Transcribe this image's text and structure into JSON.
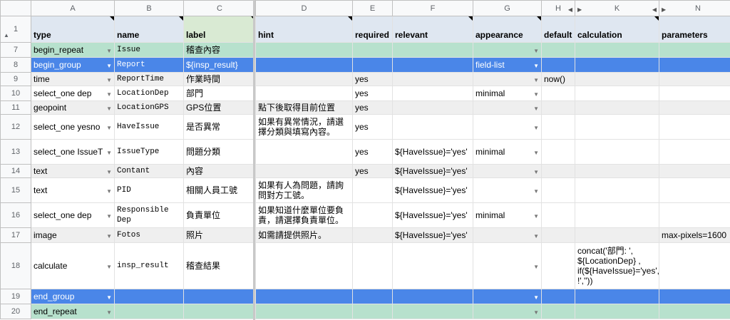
{
  "columns": [
    "A",
    "B",
    "C",
    "D",
    "E",
    "F",
    "G",
    "H",
    "K",
    "N"
  ],
  "headers": {
    "row_num": "1",
    "type": "type",
    "name": "name",
    "label": "label",
    "hint": "hint",
    "required": "required",
    "relevant": "relevant",
    "appearance": "appearance",
    "default": "default",
    "calculation": "calculation",
    "parameters": "parameters"
  },
  "rows": [
    {
      "num": "7",
      "type": "begin_repeat",
      "name": "Issue",
      "label": "稽查內容",
      "hint": "",
      "required": "",
      "relevant": "",
      "appearance": "",
      "default": "",
      "calculation": "",
      "parameters": ""
    },
    {
      "num": "8",
      "type": "begin_group",
      "name": "Report",
      "label": "${insp_result}",
      "hint": "",
      "required": "",
      "relevant": "",
      "appearance": "field-list",
      "default": "",
      "calculation": "",
      "parameters": ""
    },
    {
      "num": "9",
      "type": "time",
      "name": "ReportTime",
      "label": "作業時間",
      "hint": "",
      "required": "yes",
      "relevant": "",
      "appearance": "",
      "default": "now()",
      "calculation": "",
      "parameters": ""
    },
    {
      "num": "10",
      "type": "select_one dep",
      "name": "LocationDep",
      "label": "部門",
      "hint": "",
      "required": "yes",
      "relevant": "",
      "appearance": "minimal",
      "default": "",
      "calculation": "",
      "parameters": ""
    },
    {
      "num": "11",
      "type": "geopoint",
      "name": "LocationGPS",
      "label": "GPS位置",
      "hint": "點下後取得目前位置",
      "required": "yes",
      "relevant": "",
      "appearance": "",
      "default": "",
      "calculation": "",
      "parameters": ""
    },
    {
      "num": "12",
      "type": "select_one yesno",
      "name": "HaveIssue",
      "label": "是否異常",
      "hint": "如果有異常情況，請選擇分類與填寫內容。",
      "required": "yes",
      "relevant": "",
      "appearance": "",
      "default": "",
      "calculation": "",
      "parameters": ""
    },
    {
      "num": "13",
      "type": "select_one IssueT",
      "name": "IssueType",
      "label": "問題分類",
      "hint": "",
      "required": "yes",
      "relevant": "${HaveIssue}='yes'",
      "appearance": "minimal",
      "default": "",
      "calculation": "",
      "parameters": ""
    },
    {
      "num": "14",
      "type": "text",
      "name": "Contant",
      "label": "內容",
      "hint": "",
      "required": "yes",
      "relevant": "${HaveIssue}='yes'",
      "appearance": "",
      "default": "",
      "calculation": "",
      "parameters": ""
    },
    {
      "num": "15",
      "type": "text",
      "name": "PID",
      "label": "相關人員工號",
      "hint": "如果有人為問題，請詢問對方工號。",
      "required": "",
      "relevant": "${HaveIssue}='yes'",
      "appearance": "",
      "default": "",
      "calculation": "",
      "parameters": ""
    },
    {
      "num": "16",
      "type": "select_one dep",
      "name": "Responsible Dep",
      "label": "負責單位",
      "hint": "如果知道什麼單位要負責，請選擇負責單位。",
      "required": "",
      "relevant": "${HaveIssue}='yes'",
      "appearance": "minimal",
      "default": "",
      "calculation": "",
      "parameters": ""
    },
    {
      "num": "17",
      "type": "image",
      "name": "Fotos",
      "label": "照片",
      "hint": "如需請提供照片。",
      "required": "",
      "relevant": "${HaveIssue}='yes'",
      "appearance": "",
      "default": "",
      "calculation": "",
      "parameters": "max-pixels=1600"
    },
    {
      "num": "18",
      "type": "calculate",
      "name": "insp_result",
      "label": "稽查結果",
      "hint": "",
      "required": "",
      "relevant": "",
      "appearance": "",
      "default": "",
      "calculation": "concat('部門: ', ${LocationDep} , if(${HaveIssue}='yes','  !',''))",
      "parameters": ""
    },
    {
      "num": "19",
      "type": "end_group",
      "name": "",
      "label": "",
      "hint": "",
      "required": "",
      "relevant": "",
      "appearance": "",
      "default": "",
      "calculation": "",
      "parameters": ""
    },
    {
      "num": "20",
      "type": "end_repeat",
      "name": "",
      "label": "",
      "hint": "",
      "required": "",
      "relevant": "",
      "appearance": "",
      "default": "",
      "calculation": "",
      "parameters": ""
    }
  ]
}
